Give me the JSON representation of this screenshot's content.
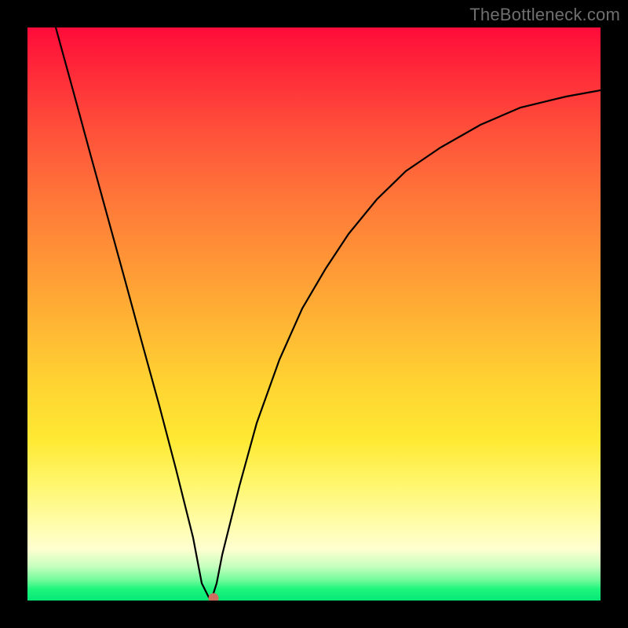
{
  "watermark": "TheBottleneck.com",
  "chart_data": {
    "type": "line",
    "title": "",
    "xlabel": "",
    "ylabel": "",
    "xlim": [
      0,
      100
    ],
    "ylim": [
      0,
      100
    ],
    "legend": false,
    "grid": false,
    "background": "red-orange-yellow-green vertical gradient (red = high, green = low)",
    "x": [
      5,
      8,
      11,
      14,
      17,
      20,
      23,
      26,
      29,
      30.5,
      32,
      33,
      34,
      37,
      40,
      44,
      48,
      52,
      56,
      61,
      66,
      72,
      79,
      86,
      94,
      100
    ],
    "values": [
      100,
      89,
      78,
      67,
      56,
      45,
      34,
      23,
      11,
      3,
      0,
      3,
      8,
      20,
      31,
      42,
      51,
      58,
      64,
      70,
      75,
      79,
      83,
      86,
      88,
      89
    ],
    "marker": {
      "x": 32.5,
      "y": 0,
      "color": "#cc6f61",
      "shape": "circle"
    },
    "annotations": []
  },
  "colors": {
    "curve": "#000000",
    "marker": "#cc6f61",
    "frame": "#000000"
  }
}
